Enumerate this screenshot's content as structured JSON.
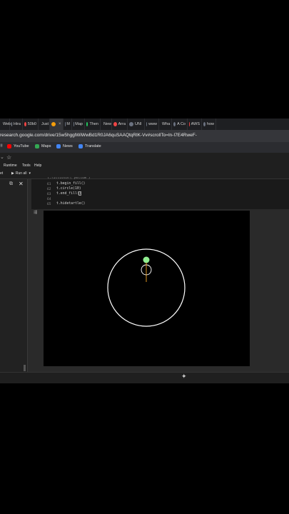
{
  "tabs": [
    {
      "label": "Web",
      "color": "#6b7280"
    },
    {
      "label": "Hira",
      "color": "#9ca3af"
    },
    {
      "label": "50b0",
      "color": "#ef4444"
    },
    {
      "label": "Just",
      "color": "#6b7280"
    },
    {
      "label": "",
      "color": "#f59e0b",
      "active": true
    },
    {
      "label": "M",
      "color": "#6b7280"
    },
    {
      "label": "Map",
      "color": "#6b7280"
    },
    {
      "label": "Then",
      "color": "#22c55e"
    },
    {
      "label": "New",
      "color": "#6b7280"
    },
    {
      "label": "Arra",
      "color": "#ef4444"
    },
    {
      "label": "UNI",
      "color": "#6b7280"
    },
    {
      "label": "www",
      "color": "#6b7280"
    },
    {
      "label": "Wha",
      "color": "#6b7280"
    },
    {
      "label": "A Co",
      "color": "#6b7280"
    },
    {
      "label": "AWS",
      "color": "#ef4444"
    },
    {
      "label": "how",
      "color": "#6b7280"
    }
  ],
  "url": "research.google.com/drive/15w5hgglWiWwBd1R0JA6quSAAQtqRlK-Vv#scrollTo=ln-I7E4RweF-",
  "bookmarks": [
    {
      "label": "YouTube",
      "color": "#ff0000"
    },
    {
      "label": "Maps",
      "color": "#34a853"
    },
    {
      "label": "News",
      "color": "#4285f4"
    },
    {
      "label": "Translate",
      "color": "#4285f4"
    }
  ],
  "menu": {
    "runtime": "Runtime",
    "tools": "Tools",
    "help": "Help"
  },
  "toolbar": {
    "left_fragment": "et",
    "run_all": "Run all"
  },
  "code": {
    "lines": [
      {
        "num": "61",
        "text": "t.begin_fill()"
      },
      {
        "num": "62",
        "text": "t.circle(10)"
      },
      {
        "num": "63",
        "text": "t.end_fill()"
      },
      {
        "num": "64",
        "text": ""
      },
      {
        "num": "65",
        "text": "t.hidetartle()"
      }
    ]
  }
}
